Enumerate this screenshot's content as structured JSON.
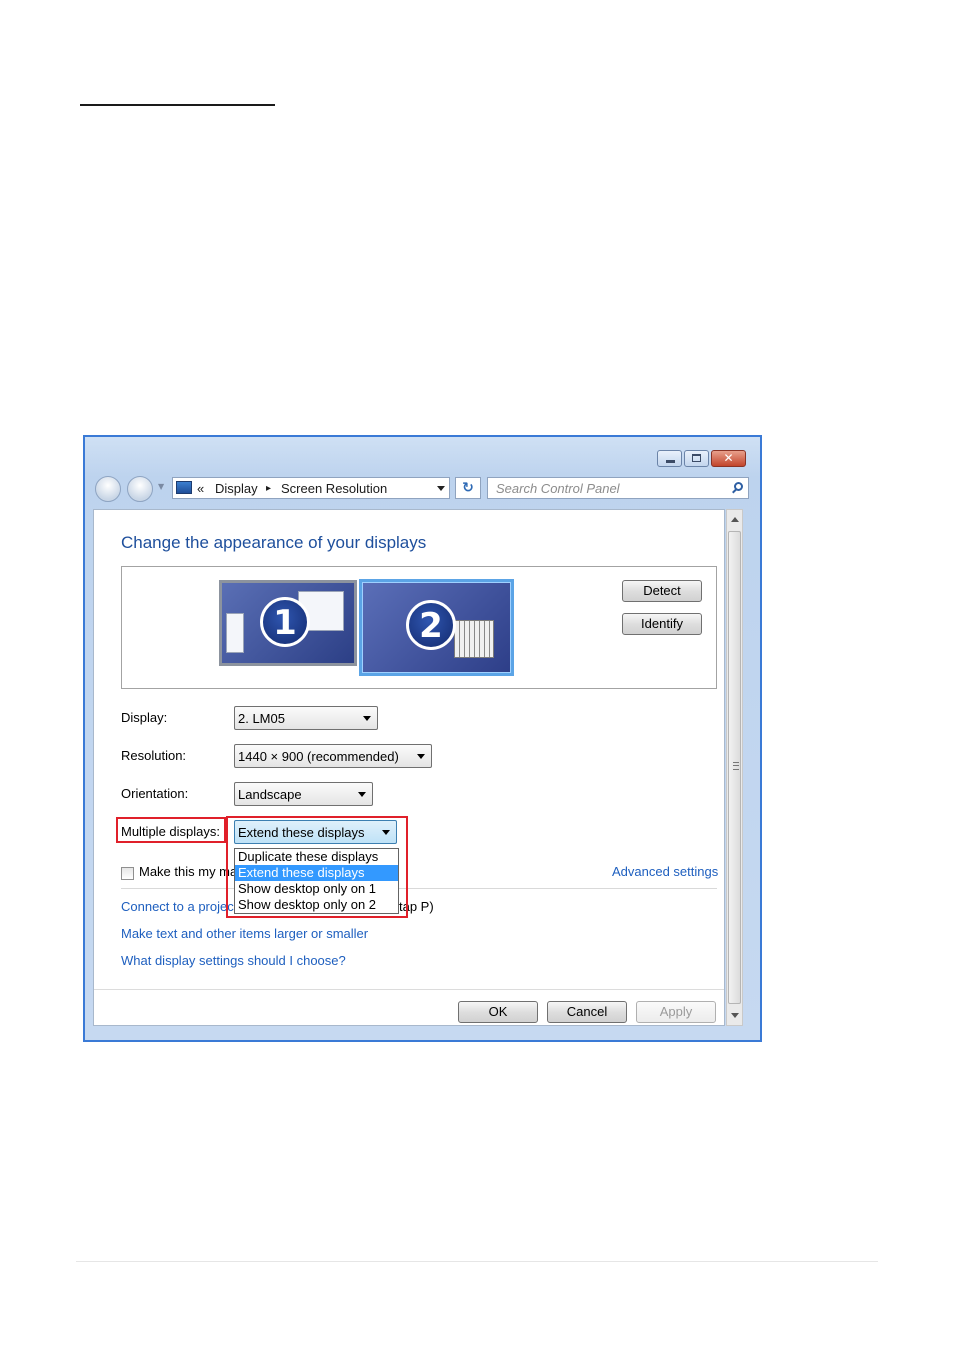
{
  "window": {
    "address": {
      "chevrons": "«",
      "crumb1": "Display",
      "separator": "▸",
      "crumb2": "Screen Resolution"
    },
    "search_placeholder": "Search Control Panel"
  },
  "main": {
    "heading": "Change the appearance of your displays",
    "monitors": [
      {
        "number": "1"
      },
      {
        "number": "2"
      }
    ],
    "detect_label": "Detect",
    "identify_label": "Identify",
    "display_label": "Display:",
    "display_value": "2. LM05",
    "resolution_label": "Resolution:",
    "resolution_value": "1440 × 900 (recommended)",
    "orientation_label": "Orientation:",
    "orientation_value": "Landscape",
    "multiple_label": "Multiple displays:",
    "multiple_value": "Extend these displays",
    "multiple_options": [
      "Duplicate these displays",
      "Extend these displays",
      "Show desktop only on 1",
      "Show desktop only on 2"
    ],
    "make_main_partial": "Make this my ma",
    "advanced_link": "Advanced settings",
    "connect_partial": "Connect to a projec",
    "connect_tail": "tap P)",
    "text_size_link": "Make text and other items larger or smaller",
    "help_link": "What display settings should I choose?",
    "ok_label": "OK",
    "cancel_label": "Cancel",
    "apply_label": "Apply"
  }
}
